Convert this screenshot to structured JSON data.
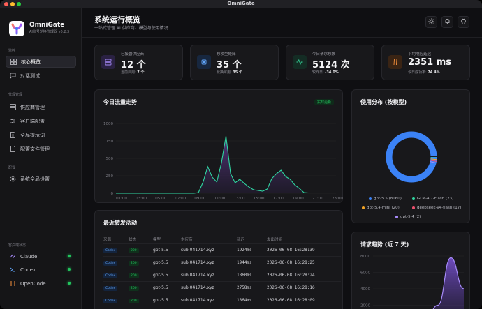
{
  "window": {
    "title": "OmniGate"
  },
  "sidebar": {
    "brand": "OmniGate",
    "brand_sub": "AI账号轮换管理器 v0.2.3",
    "sections": {
      "monitor": "监控",
      "proxy": "代理管理",
      "config": "配置",
      "client_status": "客户端状态"
    },
    "items": [
      {
        "label": "核心概览"
      },
      {
        "label": "对话测试"
      },
      {
        "label": "供应商管理"
      },
      {
        "label": "客户端配置"
      },
      {
        "label": "全局提示词"
      },
      {
        "label": "配置文件管理"
      },
      {
        "label": "系统全局设置"
      }
    ],
    "clients": [
      {
        "label": "Claude"
      },
      {
        "label": "Codex"
      },
      {
        "label": "OpenCode"
      }
    ]
  },
  "header": {
    "title": "系统运行概览",
    "subtitle": "一站式管理 AI 供应商、模型与使用情况"
  },
  "stats": [
    {
      "label": "已接管供应商",
      "value": "12 个",
      "sub_label": "当前启用:",
      "sub_value": "7 个",
      "color": "#a78bfa",
      "icon": "server-icon"
    },
    {
      "label": "总模型矩阵",
      "value": "35 个",
      "sub_label": "轮换可用:",
      "sub_value": "35 个",
      "color": "#60a5fa",
      "icon": "cpu-icon"
    },
    {
      "label": "今日请求总数",
      "value": "5124 次",
      "sub_label": "较昨日:",
      "sub_value": "-34.0%",
      "color": "#34d399",
      "icon": "activity-icon"
    },
    {
      "label": "平均响应延迟",
      "value": "2351 ms",
      "sub_label": "今日成功率:",
      "sub_value": "74.4%",
      "color": "#fb923c",
      "icon": "hash-icon"
    }
  ],
  "traffic_card": {
    "title": "今日流量走势",
    "badge": "实时更新"
  },
  "distribution_card": {
    "title": "使用分布 (按模型)"
  },
  "activity_card": {
    "title": "最近转发活动",
    "columns": [
      "来源",
      "状态",
      "模型",
      "供应商",
      "延迟",
      "发出时间"
    ],
    "rows": [
      [
        "Codex",
        "200",
        "gpt-5.5",
        "sub.041714.xyz",
        "1924ms",
        "2026-06-08 16:28:39"
      ],
      [
        "Codex",
        "200",
        "gpt-5.5",
        "sub.041714.xyz",
        "1944ms",
        "2026-06-08 16:28:25"
      ],
      [
        "Codex",
        "200",
        "gpt-5.5",
        "sub.041714.xyz",
        "1860ms",
        "2026-06-08 16:28:24"
      ],
      [
        "Codex",
        "200",
        "gpt-5.5",
        "sub.041714.xyz",
        "2758ms",
        "2026-06-08 16:28:16"
      ],
      [
        "Codex",
        "200",
        "gpt-5.5",
        "sub.041714.xyz",
        "1864ms",
        "2026-06-08 16:28:09"
      ]
    ]
  },
  "trend_card": {
    "title": "请求趋势 (近 7 天)"
  },
  "chart_data": [
    {
      "type": "area",
      "title": "今日流量走势",
      "x": [
        "01:00",
        "03:00",
        "05:00",
        "07:00",
        "09:00",
        "11:00",
        "13:00",
        "15:00",
        "17:00",
        "19:00",
        "21:00",
        "23:00"
      ],
      "ylim": [
        0,
        1000
      ],
      "yticks": [
        0,
        250,
        500,
        750,
        1000
      ],
      "series": [
        {
          "values": [
            0,
            0,
            0,
            0,
            0,
            0,
            0,
            0,
            0,
            0,
            0,
            0,
            0,
            0,
            0,
            0,
            0,
            0,
            10,
            160,
            380,
            230,
            160,
            430,
            820,
            280,
            150,
            200,
            140,
            90,
            50,
            40,
            30,
            60,
            210,
            280,
            330,
            240,
            200,
            120,
            70,
            10,
            5,
            5,
            5,
            5,
            5,
            5,
            5
          ]
        }
      ],
      "color": "#2fd6a1"
    },
    {
      "type": "pie",
      "title": "使用分布 (按模型)",
      "series": [
        {
          "name": "gpt-5.5",
          "value": 8060,
          "color": "#3b82f6"
        },
        {
          "name": "GLM-4.7-Flash",
          "value": 23,
          "color": "#2fd6a1"
        },
        {
          "name": "gpt-5.4-mini",
          "value": 20,
          "color": "#f5a524"
        },
        {
          "name": "deepseek-v4-flash",
          "value": 17,
          "color": "#f0506e"
        },
        {
          "name": "gpt-5.4",
          "value": 2,
          "color": "#a78bfa"
        }
      ],
      "legend": [
        "gpt-5.5 (8060)",
        "GLM-4.7-Flash (23)",
        "gpt-5.4-mini (20)",
        "deepseek-v4-flash (17)",
        "gpt-5.4 (2)"
      ]
    },
    {
      "type": "area",
      "title": "请求趋势 (近 7 天)",
      "ylim": [
        0,
        8000
      ],
      "yticks": [
        2000,
        4000,
        6000,
        8000
      ],
      "series": [
        {
          "values": [
            0,
            0,
            0,
            0,
            0,
            2000,
            7800,
            4000
          ]
        }
      ],
      "color": "#a78bfa"
    }
  ]
}
